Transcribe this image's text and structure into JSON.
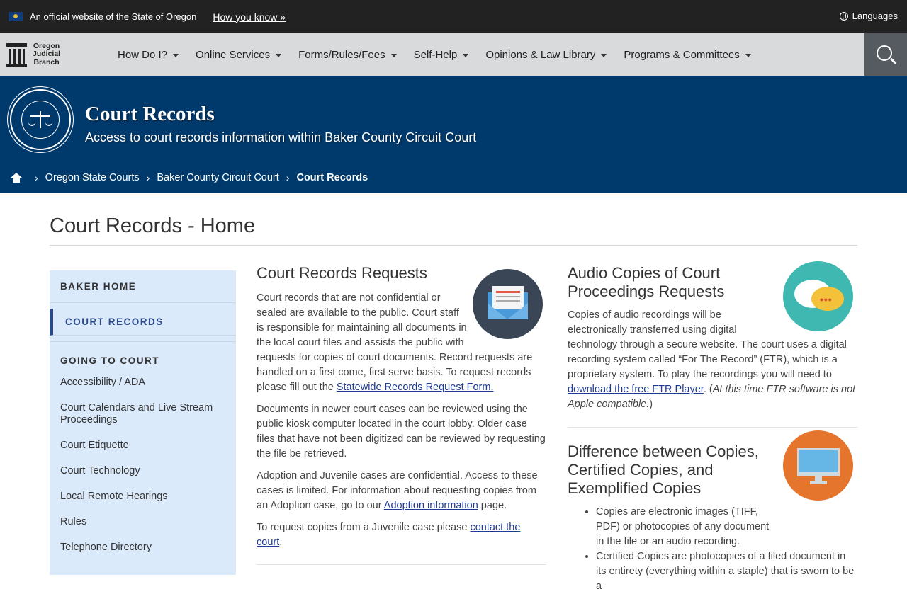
{
  "official_banner": {
    "text": "An official website of the State of Oregon",
    "how_link": "How you know »",
    "languages": "Languages"
  },
  "nav": {
    "logo_lines": [
      "Oregon",
      "Judicial",
      "Branch"
    ],
    "items": [
      {
        "label": "How Do I?"
      },
      {
        "label": "Online Services"
      },
      {
        "label": "Forms/Rules/Fees"
      },
      {
        "label": "Self-Help"
      },
      {
        "label": "Opinions & Law Library"
      },
      {
        "label": "Programs & Committees"
      }
    ]
  },
  "hero": {
    "title": "Court Records",
    "subtitle": "Access to court records information within Baker County Circuit Court"
  },
  "breadcrumb": {
    "items": [
      "Oregon State Courts",
      "Baker County Circuit Court"
    ],
    "current": "Court Records"
  },
  "page_title": "Court Records - Home",
  "sidebar": {
    "home": "BAKER HOME",
    "current": "COURT RECORDS",
    "group": "GOING TO COURT",
    "links": [
      "Accessibility / ADA",
      "Court Calendars and Live Stream Proceedings",
      "Court Etiquette",
      "Court Technology",
      "Local Remote Hearings",
      "Rules",
      "Telephone Directory"
    ]
  },
  "requests": {
    "title": "Court Records Requests",
    "p1": "Court records that are not confidential or sealed are available to the public. Court staff is responsible for maintaining all documents in the local court files and assists the public with requests for copies of court documents. Record requests are handled on a first come, first serve basis. To request records please fill out the ",
    "p1_link": "Statewide Records Request Form.",
    "p2": "Documents in newer court cases can be reviewed using the public kiosk computer located in the court lobby. Older case files that have not been digitized can be reviewed by requesting the file be retrieved.",
    "p3_a": "Adoption and Juvenile cases are confidential. Access to these cases is limited. For information about requesting copies from an Adoption case, go to our ",
    "p3_link": "Adoption information",
    "p3_b": " page.",
    "p4_a": "To request copies from a Juvenile case please ",
    "p4_link": "contact the court",
    "p4_b": "."
  },
  "audio": {
    "title": "Audio Copies of Court Proceedings Requests",
    "p_a": "Copies of audio recordings will be electronically transferred using digital technology through a secure website. The court uses a digital recording system called “For The Record” (FTR), which is a proprietary system. To play the recordings you will need to ",
    "p_link": "download the free FTR Player",
    "p_b": ". (",
    "p_italic": "At this time FTR software is not Apple compatible.",
    "p_c": ")"
  },
  "copies": {
    "title": "Difference between Copies, Certified Copies, and Exemplified Copies",
    "bullets": [
      "Copies are electronic images (TIFF, PDF) or photocopies of any document in the file or an audio recording.",
      "Certified Copies are photocopies of a filed document in its entirety (everything within a staple) that is sworn to be a"
    ]
  },
  "colors": {
    "header_blue": "#003a6c",
    "nav_gray": "#d9dadb",
    "sidebar_bg": "#dbeafb",
    "accent": "#2c4a8a"
  }
}
